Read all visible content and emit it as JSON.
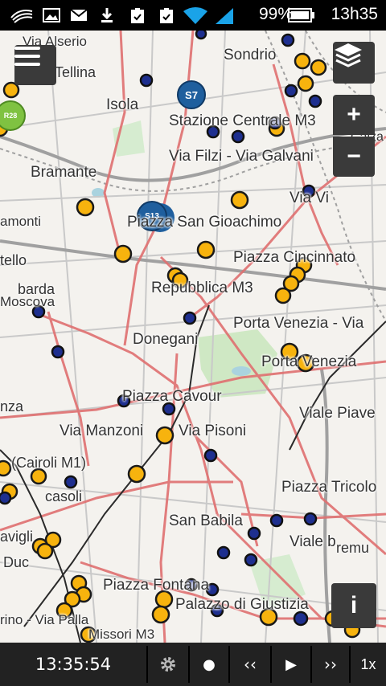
{
  "status_bar": {
    "battery_percent": "99%",
    "time": "13h35",
    "icons": [
      "swoosh-icon",
      "image-icon",
      "mail-icon",
      "download-icon",
      "clipboard-check-icon",
      "clipboard-check-icon",
      "wifi-icon",
      "cell-signal-icon",
      "battery-icon"
    ]
  },
  "map": {
    "station_labels": [
      "Via Alserio",
      "Sondrio",
      "Tellina",
      "Isola",
      "Stazione Centrale M3",
      "Calza",
      "Via Filzi - Via Galvani",
      "Bramante",
      "Via Vi",
      "Piazza San Gioachimo",
      "amonti",
      "Piazza Cincinnato",
      "tello",
      "Repubblica M3",
      "barda",
      "Moscova",
      "Porta Venezia - Via",
      "Donegani",
      "Porta Venezia",
      "Piazza Cavour",
      "Viale Piave",
      "nza",
      "Via Manzoni",
      "Via Pisoni",
      "(Cairoli M1)",
      "casoli",
      "Piazza Tricolo",
      "San Babila",
      "Viale b",
      "avigli",
      "remu",
      "Duc",
      "Piazza Fontana",
      "Palazzo di Giustizia",
      "rino - Via Palla",
      "Missori M3"
    ],
    "badges": [
      {
        "text": "S7",
        "color": "#1f5f9e"
      },
      {
        "text": "S13",
        "color": "#1f5f9e"
      },
      {
        "text": "R28",
        "color": "#7fc241"
      }
    ],
    "controls": {
      "menu_icon": "hamburger-icon",
      "layers_icon": "layers-icon",
      "zoom_in": "+",
      "zoom_out": "−",
      "info": "i"
    }
  },
  "bottom_bar": {
    "clock": "13:35:54",
    "settings_icon": "gear-icon",
    "record": "●",
    "rewind": "‹‹",
    "play": "▶",
    "forward": "››",
    "speed": "1x"
  },
  "colors": {
    "stop_yellow": "#f7b30e",
    "stop_blue": "#1e2f8f",
    "route_red": "#e07070",
    "park_green": "#cfe8c4"
  }
}
